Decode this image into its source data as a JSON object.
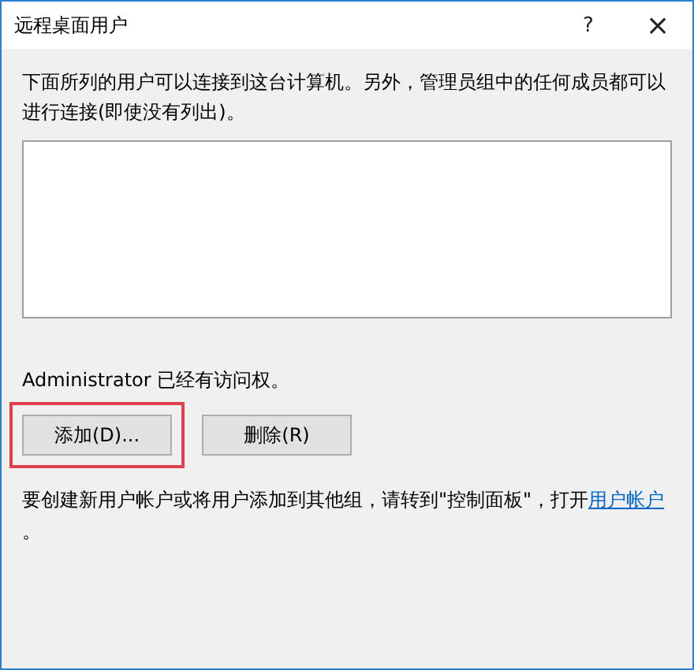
{
  "window": {
    "title": "远程桌面用户",
    "help": "?",
    "close": "×"
  },
  "description": "下面所列的用户可以连接到这台计算机。另外，管理员组中的任何成员都可以进行连接(即使没有列出)。",
  "access_note": "Administrator 已经有访问权。",
  "buttons": [
    {
      "label": "添加(D)...",
      "highlighted": true
    },
    {
      "label": "删除(R)",
      "highlighted": false
    }
  ],
  "footer": {
    "text": "要创建新用户帐户或将用户添加到其他组，请转到\"控制面板\"，打开",
    "link": "用户帐户",
    "end": "。"
  }
}
